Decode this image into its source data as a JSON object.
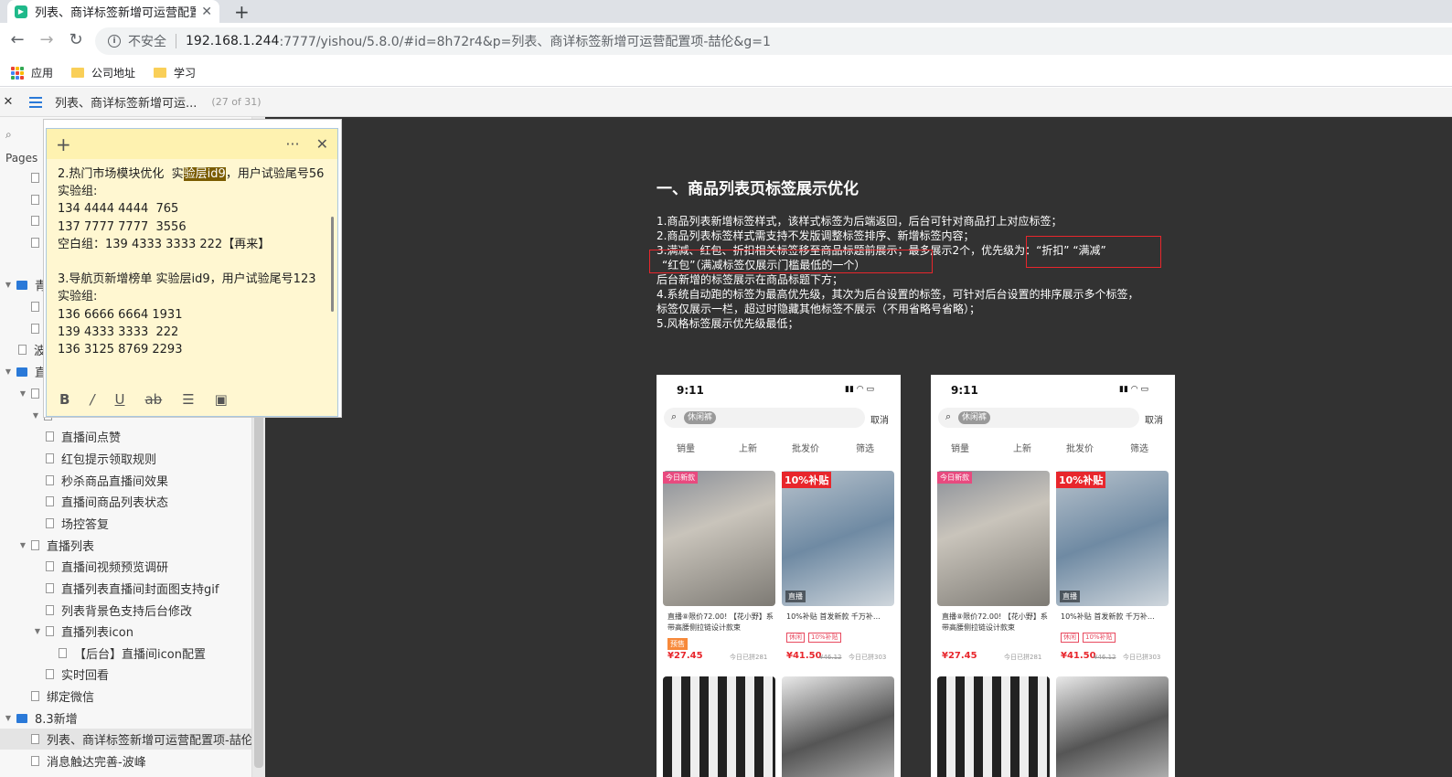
{
  "browser": {
    "tab_title": "列表、商详标签新增可运营配置项",
    "url_insecure_label": "不安全",
    "url_host": "192.168.1.244",
    "url_path": ":7777/yishou/5.8.0/#id=8h72r4&p=列表、商详标签新增可运营配置项-喆伦&g=1",
    "bookmarks": [
      "应用",
      "公司地址",
      "学习"
    ]
  },
  "toolbar": {
    "doc_title": "列表、商详标签新增可运...",
    "page_count": "(27 of 31)"
  },
  "sidebar": {
    "pages_label": "Pages",
    "items": [
      {
        "label": "青",
        "type": "folder",
        "depth": 0
      },
      {
        "label": "波",
        "type": "page",
        "depth": 1
      },
      {
        "label": "直",
        "type": "folder",
        "depth": 0
      },
      {
        "label": "直播间点赞",
        "type": "page",
        "depth": 3
      },
      {
        "label": "红包提示领取规则",
        "type": "page",
        "depth": 3
      },
      {
        "label": "秒杀商品直播间效果",
        "type": "page",
        "depth": 3
      },
      {
        "label": "直播间商品列表状态",
        "type": "page",
        "depth": 3
      },
      {
        "label": "场控答复",
        "type": "page",
        "depth": 3
      },
      {
        "label": "直播列表",
        "type": "page",
        "depth": 2
      },
      {
        "label": "直播间视频预览调研",
        "type": "page",
        "depth": 3
      },
      {
        "label": "直播列表直播间封面图支持gif",
        "type": "page",
        "depth": 3
      },
      {
        "label": "列表背景色支持后台修改",
        "type": "page",
        "depth": 3
      },
      {
        "label": "直播列表icon",
        "type": "page",
        "depth": 3
      },
      {
        "label": "【后台】直播间icon配置",
        "type": "page",
        "depth": 4
      },
      {
        "label": "实时回看",
        "type": "page",
        "depth": 3
      },
      {
        "label": "绑定微信",
        "type": "page",
        "depth": 2
      },
      {
        "label": "8.3新增",
        "type": "folder",
        "depth": 0
      },
      {
        "label": "列表、商详标签新增可运营配置项-喆伦",
        "type": "page",
        "depth": 2
      },
      {
        "label": "消息触达完善-波峰",
        "type": "page",
        "depth": 2
      }
    ]
  },
  "note": {
    "line1_pre": "2.热门市场模块优化  实",
    "line1_hl": "验层id9",
    "line1_post": "，用户试验尾号56",
    "body": "实验组:\n134 4444 4444  765\n137 7777 7777  3556\n空白组：139 4333 3333 222【再来】\n\n3.导航页新增榜单 实验层id9，用户试验尾号123\n实验组:\n136 6666 6664 1931\n139 4333 3333  222\n136 3125 8769 2293"
  },
  "doc": {
    "heading": "一、商品列表页标签展示优化",
    "lines": [
      "1.商品列表新增标签样式，该样式标签为后端返回，后台可针对商品打上对应标签；",
      "2.商品列表标签样式需支持不发版调整标签排序、新增标签内容；",
      "3.满减、红包、折扣相关标签移至商品标题前展示；最多展示2个，优先级为：“折扣” “满减”",
      "“红包”（满减标签仅展示门槛最低的一个）",
      "后台新增的标签展示在商品标题下方；",
      "4.系统自动跑的标签为最高优先级，其次为后台设置的标签，可针对后台设置的排序展示多个标签，",
      "标签仅展示一栏，超过时隐藏其他标签不展示（不用省略号省略）；",
      "5.风格标签展示优先级最低；"
    ]
  },
  "phone": {
    "time": "9:11",
    "chip": "休闲裤",
    "cancel": "取消",
    "sorts": [
      "销量",
      "上新",
      "批发价",
      "筛选"
    ],
    "badge_new": "今日新款",
    "badge_sub": "10%补贴",
    "item1_name": "直播⑧限价72.00! 【花小野】系带高腰侧拉链设计款束",
    "item1_price": "¥27.45",
    "item1_sold": "今日已拼281",
    "item1_tag": "预售",
    "item2_name": "10%补贴 首发新款 千万补…",
    "item2_tags": [
      "休闲",
      "10%补贴"
    ],
    "item2_price": "¥41.50",
    "item2_old": "¥46.12",
    "item2_sold": "今日已拼303",
    "live": "直播"
  }
}
